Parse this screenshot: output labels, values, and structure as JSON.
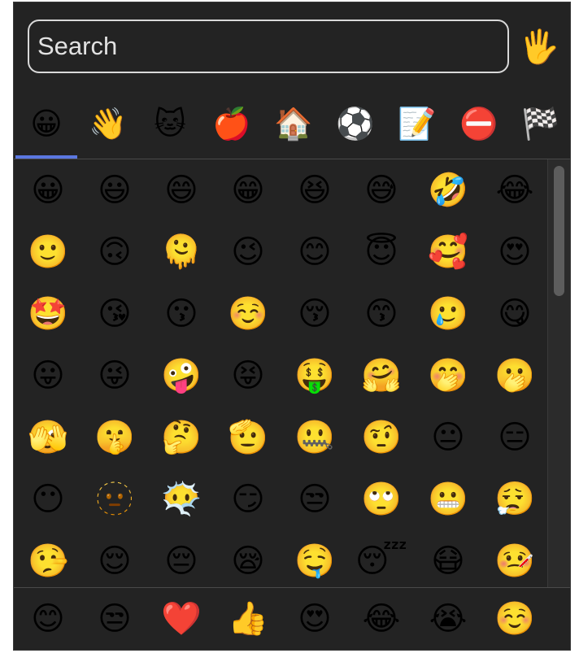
{
  "search": {
    "placeholder": "Search",
    "value": ""
  },
  "skin_tone": {
    "icon": "raised-hand-icon",
    "glyph": "🖐️"
  },
  "categories": [
    {
      "name": "smileys",
      "glyph": "😀",
      "selected": true
    },
    {
      "name": "people",
      "glyph": "👋"
    },
    {
      "name": "animals",
      "glyph": "🐱"
    },
    {
      "name": "food",
      "glyph": "🍎"
    },
    {
      "name": "travel",
      "glyph": "🏠"
    },
    {
      "name": "activities",
      "glyph": "⚽"
    },
    {
      "name": "objects",
      "glyph": "📝"
    },
    {
      "name": "symbols",
      "glyph": "⛔"
    },
    {
      "name": "flags",
      "glyph": "🏁"
    }
  ],
  "accent_color": "#5b77e0",
  "emoji_grid": [
    [
      "😀",
      "😃",
      "😄",
      "😁",
      "😆",
      "😅",
      "🤣",
      "😂"
    ],
    [
      "🙂",
      "🙃",
      "🫠",
      "😉",
      "😊",
      "😇",
      "🥰",
      "😍"
    ],
    [
      "🤩",
      "😘",
      "😗",
      "☺️",
      "😚",
      "😙",
      "🥲",
      "😋"
    ],
    [
      "😛",
      "😜",
      "🤪",
      "😝",
      "🤑",
      "🤗",
      "🤭",
      "🫢"
    ],
    [
      "🫣",
      "🤫",
      "🤔",
      "🫡",
      "🤐",
      "🤨",
      "😐",
      "😑"
    ],
    [
      "😶",
      "🫥",
      "😶‍🌫️",
      "😏",
      "😒",
      "🙄",
      "😬",
      "😮‍💨"
    ],
    [
      "🤥",
      "😌",
      "😔",
      "😪",
      "🤤",
      "😴",
      "😷",
      "🤒"
    ]
  ],
  "recent": [
    "😊",
    "😒",
    "❤️",
    "👍",
    "😍",
    "😂",
    "😭",
    "☺️"
  ]
}
